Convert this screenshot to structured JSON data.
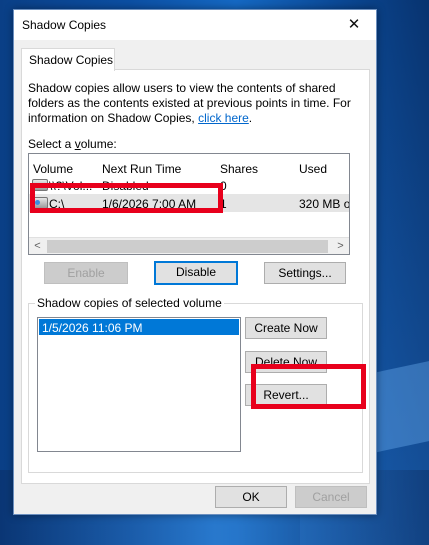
{
  "window": {
    "title": "Shadow Copies",
    "close_glyph": "✕"
  },
  "tab": {
    "label": "Shadow Copies"
  },
  "description": {
    "text": "Shadow copies allow users to view the contents of shared folders as the contents existed at previous points in time. For information on Shadow Copies, ",
    "link": "click here",
    "end": "."
  },
  "volumes": {
    "label": "Select a volume:",
    "headers": {
      "volume": "Volume",
      "next_run": "Next Run Time",
      "shares": "Shares",
      "used": "Used"
    },
    "rows": [
      {
        "volume": "\\\\?\\Vol...",
        "next_run": "Disabled",
        "shares": "0",
        "used": "",
        "icon": "drive-icon"
      },
      {
        "volume": "C:\\",
        "next_run": "1/6/2026 7:00 AM",
        "shares": "1",
        "used": "320 MB o",
        "icon": "network-drive-icon"
      }
    ]
  },
  "buttons": {
    "enable": "Enable",
    "disable": "Disable",
    "settings": "Settings...",
    "create_now": "Create Now",
    "delete_now": "Delete Now",
    "revert": "Revert...",
    "ok": "OK",
    "cancel": "Cancel"
  },
  "snapshots": {
    "label": "Shadow copies of selected volume",
    "items": [
      "1/5/2026 11:06 PM"
    ]
  },
  "colors": {
    "highlight": "#e8001c",
    "selection": "#0078d7",
    "link": "#0066cc"
  }
}
